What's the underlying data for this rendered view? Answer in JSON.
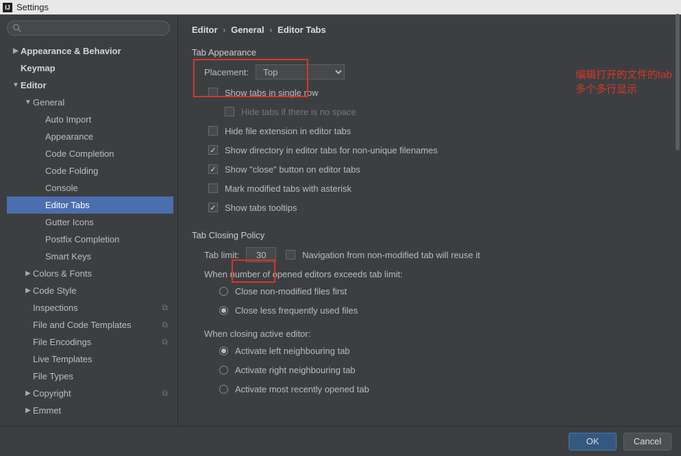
{
  "window": {
    "title": "Settings"
  },
  "sidebar": {
    "items": [
      {
        "label": "Appearance & Behavior",
        "arrow": "right",
        "bold": true,
        "indent": 0
      },
      {
        "label": "Keymap",
        "arrow": "",
        "bold": true,
        "indent": 0
      },
      {
        "label": "Editor",
        "arrow": "down",
        "bold": true,
        "indent": 0
      },
      {
        "label": "General",
        "arrow": "down",
        "bold": false,
        "indent": 1
      },
      {
        "label": "Auto Import",
        "arrow": "",
        "bold": false,
        "indent": 2
      },
      {
        "label": "Appearance",
        "arrow": "",
        "bold": false,
        "indent": 2
      },
      {
        "label": "Code Completion",
        "arrow": "",
        "bold": false,
        "indent": 2
      },
      {
        "label": "Code Folding",
        "arrow": "",
        "bold": false,
        "indent": 2
      },
      {
        "label": "Console",
        "arrow": "",
        "bold": false,
        "indent": 2
      },
      {
        "label": "Editor Tabs",
        "arrow": "",
        "bold": false,
        "indent": 2,
        "selected": true
      },
      {
        "label": "Gutter Icons",
        "arrow": "",
        "bold": false,
        "indent": 2
      },
      {
        "label": "Postfix Completion",
        "arrow": "",
        "bold": false,
        "indent": 2
      },
      {
        "label": "Smart Keys",
        "arrow": "",
        "bold": false,
        "indent": 2
      },
      {
        "label": "Colors & Fonts",
        "arrow": "right",
        "bold": false,
        "indent": 1
      },
      {
        "label": "Code Style",
        "arrow": "right",
        "bold": false,
        "indent": 1
      },
      {
        "label": "Inspections",
        "arrow": "",
        "bold": false,
        "indent": 1,
        "copy": true
      },
      {
        "label": "File and Code Templates",
        "arrow": "",
        "bold": false,
        "indent": 1,
        "copy": true
      },
      {
        "label": "File Encodings",
        "arrow": "",
        "bold": false,
        "indent": 1,
        "copy": true
      },
      {
        "label": "Live Templates",
        "arrow": "",
        "bold": false,
        "indent": 1
      },
      {
        "label": "File Types",
        "arrow": "",
        "bold": false,
        "indent": 1
      },
      {
        "label": "Copyright",
        "arrow": "right",
        "bold": false,
        "indent": 1,
        "copy": true
      },
      {
        "label": "Emmet",
        "arrow": "right",
        "bold": false,
        "indent": 1
      }
    ]
  },
  "breadcrumb": {
    "a": "Editor",
    "b": "General",
    "c": "Editor Tabs"
  },
  "section1": {
    "title": "Tab Appearance",
    "placement_label": "Placement:",
    "placement_value": "Top",
    "cb_single_row": "Show tabs in single row",
    "cb_hide_no_space": "Hide tabs if there is no space",
    "cb_hide_ext": "Hide file extension in editor tabs",
    "cb_show_dir": "Show directory in editor tabs for non-unique filenames",
    "cb_show_close": "Show \"close\" button on editor tabs",
    "cb_mark_modified": "Mark modified tabs with asterisk",
    "cb_tooltips": "Show tabs tooltips"
  },
  "annotation": "编辑打开的文件的tab多个多行显示",
  "section2": {
    "title": "Tab Closing Policy",
    "tab_limit_label": "Tab limit:",
    "tab_limit_value": "30",
    "cb_nav_reuse": "Navigation from non-modified tab will reuse it",
    "exceed_label": "When number of opened editors exceeds tab limit:",
    "r_close_nonmod": "Close non-modified files first",
    "r_close_lru": "Close less frequently used files",
    "closing_label": "When closing active editor:",
    "r_activate_left": "Activate left neighbouring tab",
    "r_activate_right": "Activate right neighbouring tab",
    "r_activate_mru": "Activate most recently opened tab"
  },
  "footer": {
    "ok": "OK",
    "cancel": "Cancel"
  }
}
